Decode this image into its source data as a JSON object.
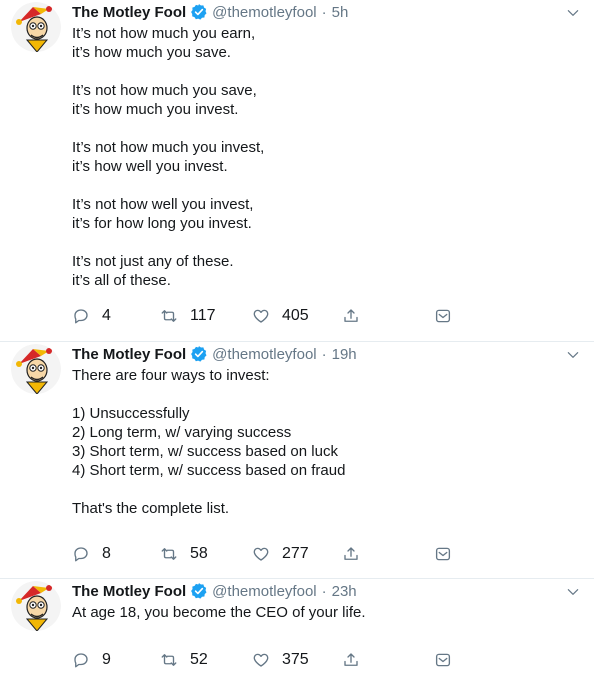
{
  "colors": {
    "verified": "#1da1f2",
    "muted": "#657786",
    "text": "#14171a",
    "divider": "#e6ecf0"
  },
  "tweets": [
    {
      "name": "The Motley Fool",
      "handle": "@themotleyfool",
      "dot": "·",
      "time": "5h",
      "text": "It’s not how much you earn,\nit’s how much you save.\n\nIt’s not how much you save,\nit’s how much you invest.\n\nIt’s not how much you invest,\nit’s how well you invest.\n\nIt’s not how well you invest,\nit’s for how long you invest.\n\nIt’s not just any of these.\nit’s all of these.",
      "replies": "4",
      "retweets": "117",
      "likes": "405"
    },
    {
      "name": "The Motley Fool",
      "handle": "@themotleyfool",
      "dot": "·",
      "time": "19h",
      "text": "There are four ways to invest:\n\n1) Unsuccessfully\n2) Long term, w/ varying success\n3) Short term, w/ success based on luck\n4) Short term, w/ success based on fraud\n\nThat's the complete list.",
      "replies": "8",
      "retweets": "58",
      "likes": "277"
    },
    {
      "name": "The Motley Fool",
      "handle": "@themotleyfool",
      "dot": "·",
      "time": "23h",
      "text": "At age 18, you become the CEO of your life.",
      "replies": "9",
      "retweets": "52",
      "likes": "375"
    }
  ],
  "icons": {
    "avatar": "jester-avatar-icon",
    "verified": "verified-badge-icon",
    "menu": "chevron-down-icon",
    "reply": "reply-icon",
    "retweet": "retweet-icon",
    "like": "heart-icon",
    "share": "share-icon",
    "dm": "direct-message-icon"
  }
}
